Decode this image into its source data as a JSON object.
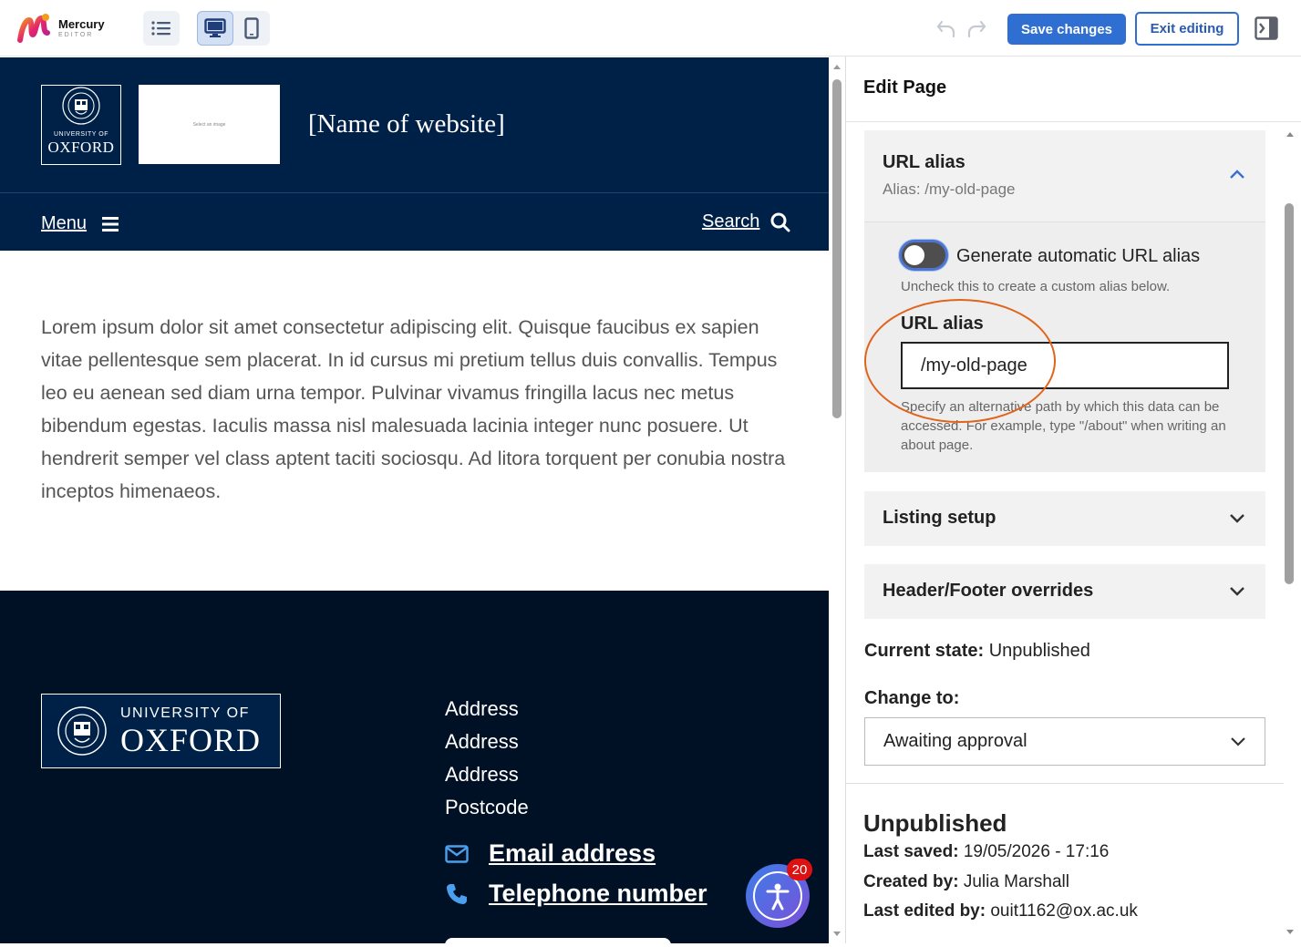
{
  "app": {
    "name": "Mercury",
    "subtitle": "EDITOR",
    "save_label": "Save changes",
    "exit_label": "Exit editing"
  },
  "preview": {
    "site_title": "[Name of website]",
    "image_placeholder": "Select an image",
    "crest_small": "UNIVERSITY OF",
    "crest_big": "OXFORD",
    "menu_label": "Menu",
    "search_label": "Search",
    "body": "Lorem ipsum dolor sit amet consectetur adipiscing elit. Quisque faucibus ex sapien vitae pellentesque sem placerat. In id cursus mi pretium tellus duis convallis. Tempus leo eu aenean sed diam urna tempor. Pulvinar vivamus fringilla lacus nec metus bibendum egestas. Iaculis massa nisl malesuada lacinia integer nunc posuere. Ut hendrerit semper vel class aptent taciti sociosqu. Ad litora torquent per conubia nostra inceptos himenaeos.",
    "footer": {
      "logo_small": "UNIVERSITY OF",
      "logo_big": "OXFORD",
      "address_lines": [
        "Address",
        "Address",
        "Address",
        "Postcode"
      ],
      "email_label": "Email address",
      "phone_label": "Telephone number"
    },
    "accessibility_badge": "20"
  },
  "sidebar": {
    "title": "Edit Page",
    "url_section": {
      "title": "URL alias",
      "subtitle": "Alias: /my-old-page",
      "toggle_label": "Generate automatic URL alias",
      "toggle_help": "Uncheck this to create a custom alias below.",
      "toggle_on": false,
      "field_label": "URL alias",
      "field_value": "/my-old-page",
      "field_help": "Specify an alternative path by which this data can be accessed. For example, type \"/about\" when writing an about page."
    },
    "listing_setup": "Listing setup",
    "header_footer": "Header/Footer overrides",
    "current_state_label": "Current state:",
    "current_state_value": "Unpublished",
    "change_to_label": "Change to:",
    "change_to_value": "Awaiting approval",
    "status_title": "Unpublished",
    "last_saved_label": "Last saved:",
    "last_saved_value": "19/05/2026 - 17:16",
    "created_by_label": "Created by:",
    "created_by_value": "Julia Marshall",
    "last_edited_label": "Last edited by:",
    "last_edited_value": "ouit1162@ox.ac.uk"
  },
  "colors": {
    "brand_navy": "#002147",
    "footer_navy": "#001125",
    "accent_blue": "#2f6fd1",
    "highlight_orange": "#e0641c"
  }
}
